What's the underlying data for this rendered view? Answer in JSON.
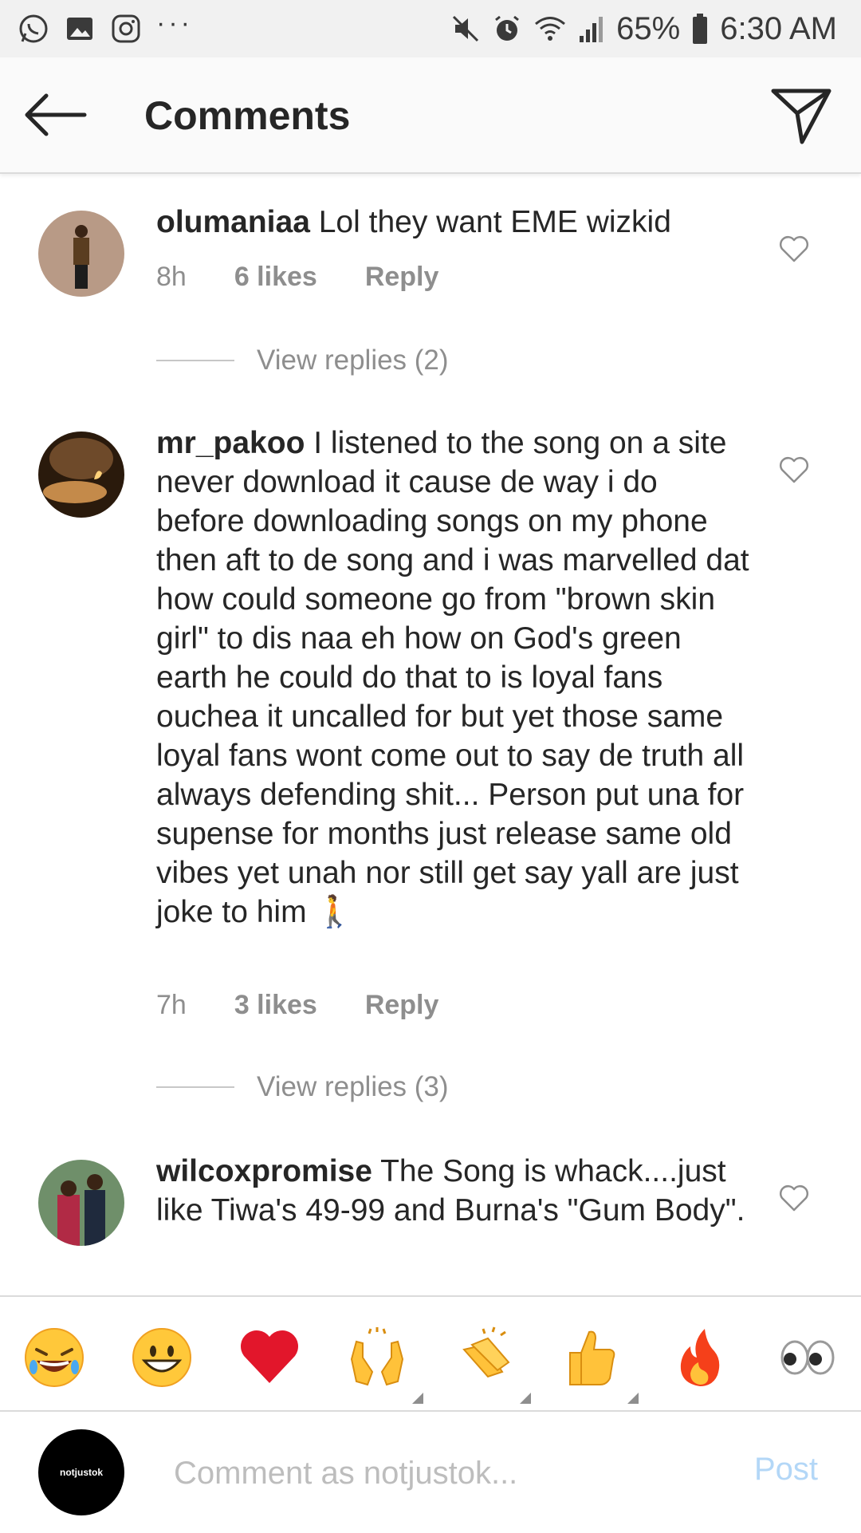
{
  "status_bar": {
    "left_icons": [
      "whatsapp-icon",
      "gallery-icon",
      "instagram-icon",
      "more-icon"
    ],
    "more": "···",
    "battery": "65%",
    "time": "6:30 AM",
    "right_icons": [
      "mute-icon",
      "alarm-icon",
      "wifi-icon",
      "signal-icon",
      "battery-icon"
    ]
  },
  "header": {
    "title": "Comments",
    "back_icon": "arrow-left-icon",
    "send_icon": "send-icon"
  },
  "comments": [
    {
      "username": "olumaniaa",
      "text": " Lol they want EME wizkid",
      "time": "8h",
      "likes": "6 likes",
      "reply": "Reply",
      "view_replies": "View replies (2)"
    },
    {
      "username": "mr_pakoo",
      "text": " I listened to the song on a site never download it cause de way i do before downloading songs on my phone then aft to de song and i was marvelled dat how could someone go from \"brown skin girl\" to dis naa eh how on God's green earth he could do that to is loyal fans ouchea it uncalled for but yet those same loyal fans wont come out to say de truth all always defending shit... Person put una for supense for months just release same old vibes yet unah nor still get say yall are just joke to him 🚶",
      "time": "7h",
      "likes": "3 likes",
      "reply": "Reply",
      "view_replies": "View replies (3)"
    },
    {
      "username": "wilcoxpromise",
      "text": " The Song is whack....just like Tiwa's 49-99 and Burna's \"Gum Body\".",
      "time": "",
      "likes": "",
      "reply": ""
    }
  ],
  "emoji_bar": [
    "😂",
    "😃",
    "❤️",
    "🙌",
    "👏",
    "👍",
    "🔥",
    "👀"
  ],
  "comment_input": {
    "placeholder": "Comment as notjustok...",
    "post_label": "Post",
    "avatar_text": "notjustok"
  }
}
